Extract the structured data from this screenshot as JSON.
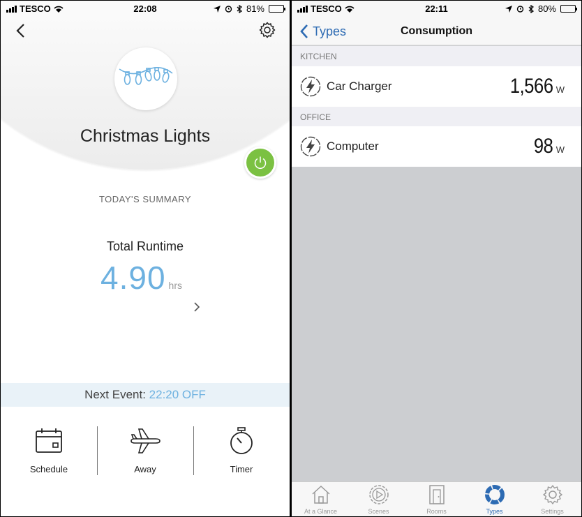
{
  "left_screen": {
    "status": {
      "carrier": "TESCO",
      "time": "22:08",
      "battery": "81%",
      "battery_level": 0.81
    },
    "device_name": "Christmas Lights",
    "power_state": "on",
    "summary_label": "TODAY'S SUMMARY",
    "runtime": {
      "label": "Total Runtime",
      "value": "4.90",
      "unit": "hrs"
    },
    "next_event": {
      "label": "Next Event:",
      "value": "22:20 OFF"
    },
    "actions": [
      {
        "label": "Schedule",
        "icon": "calendar-icon"
      },
      {
        "label": "Away",
        "icon": "airplane-icon"
      },
      {
        "label": "Timer",
        "icon": "stopwatch-icon"
      }
    ],
    "colors": {
      "power_green": "#7bc142",
      "accent_blue": "#6db1e0"
    }
  },
  "right_screen": {
    "status": {
      "carrier": "TESCO",
      "time": "22:11",
      "battery": "80%",
      "battery_level": 0.8
    },
    "nav": {
      "back_label": "Types",
      "title": "Consumption"
    },
    "sections": [
      {
        "header": "KITCHEN",
        "items": [
          {
            "name": "Car Charger",
            "value": "1,566",
            "unit": "W"
          }
        ]
      },
      {
        "header": "OFFICE",
        "items": [
          {
            "name": "Computer",
            "value": "98",
            "unit": "W"
          }
        ]
      }
    ],
    "tabs": [
      {
        "label": "At a Glance",
        "icon": "house-icon",
        "active": false
      },
      {
        "label": "Scenes",
        "icon": "scenes-icon",
        "active": false
      },
      {
        "label": "Rooms",
        "icon": "door-icon",
        "active": false
      },
      {
        "label": "Types",
        "icon": "types-icon",
        "active": true
      },
      {
        "label": "Settings",
        "icon": "gear-icon",
        "active": false
      }
    ],
    "colors": {
      "accent": "#2d6bb3"
    }
  }
}
